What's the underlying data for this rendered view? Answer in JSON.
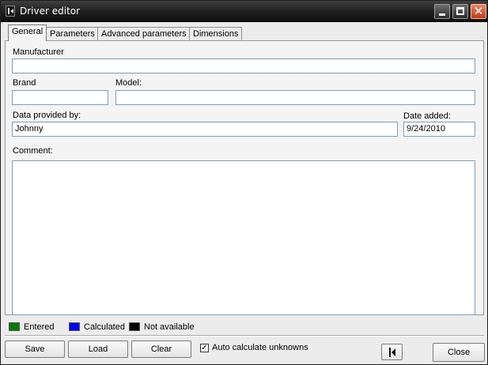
{
  "window": {
    "title": "Driver editor"
  },
  "tabs": [
    {
      "label": "General",
      "active": true
    },
    {
      "label": "Parameters",
      "active": false
    },
    {
      "label": "Advanced parameters",
      "active": false
    },
    {
      "label": "Dimensions",
      "active": false
    }
  ],
  "form": {
    "manufacturer_label": "Manufacturer",
    "manufacturer_value": "",
    "brand_label": "Brand",
    "brand_value": "",
    "model_label": "Model:",
    "model_value": "",
    "provided_by_label": "Data provided by:",
    "provided_by_value": "Johnny",
    "date_added_label": "Date added:",
    "date_added_value": "9/24/2010",
    "comment_label": "Comment:",
    "comment_value": ""
  },
  "legend": [
    {
      "label": "Entered",
      "color": "#007a00"
    },
    {
      "label": "Calculated",
      "color": "#0000ff"
    },
    {
      "label": "Not available",
      "color": "#000000"
    }
  ],
  "buttons": {
    "save": "Save",
    "load": "Load",
    "clear": "Clear",
    "close": "Close"
  },
  "auto_calc": {
    "label": "Auto calculate unknowns",
    "checked": true,
    "mark": "✓"
  }
}
